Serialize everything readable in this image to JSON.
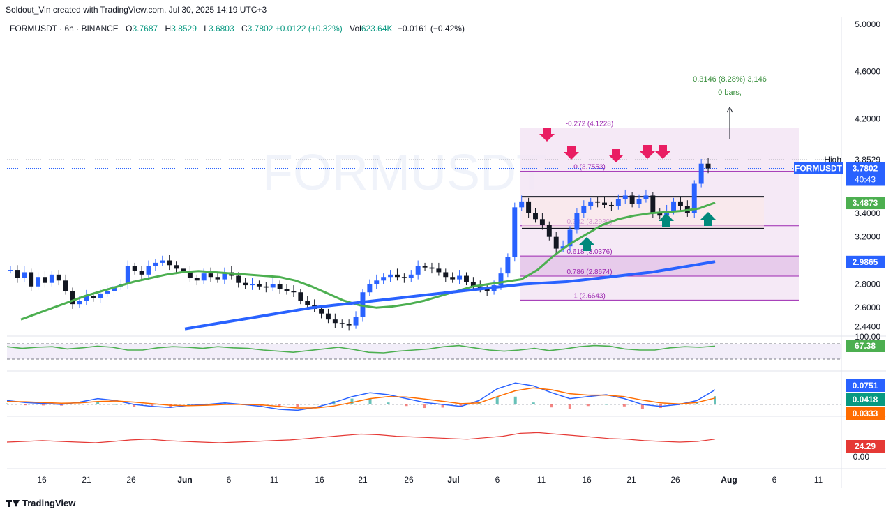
{
  "header": {
    "caption": "Soldout_Vin created with TradingView.com, Jul 30, 2025 14:19 UTC+3"
  },
  "legend": {
    "symbol": "FORMUSDT · 6h · BINANCE",
    "o_label": "O",
    "o": "3.7687",
    "h_label": "H",
    "h": "3.8529",
    "l_label": "L",
    "l": "3.6803",
    "c_label": "C",
    "c": "3.7802",
    "change": "+0.0122 (+0.32%)",
    "vol_label": "Vol",
    "vol": "623.64K",
    "vol_change": "−0.0161 (−0.42%)"
  },
  "footer": {
    "brand": "TradingView"
  },
  "colors": {
    "up": "#089981",
    "down": "#131722",
    "candle_up": "#2962ff",
    "ma_fast": "#4caf50",
    "ma_slow": "#2962ff",
    "fib": "#9c27b0",
    "arrow_down": "#e91e63",
    "arrow_up": "#00897b",
    "rsi": "#4caf50",
    "macd": "#2962ff",
    "signal": "#ff6d00",
    "adx": "#e53935"
  },
  "chart_data": {
    "type": "candlestick",
    "symbol": "FORMUSDT",
    "timeframe": "6h",
    "exchange": "BINANCE",
    "watermark": "FORMUSDT",
    "y_ticks": [
      "5.0000",
      "4.6000",
      "4.2000",
      "3.8529",
      "3.7802",
      "3.4000",
      "3.2000",
      "2.8000",
      "2.6000",
      "2.4400"
    ],
    "y_tick_values": [
      5.0,
      4.6,
      4.2,
      3.4,
      3.2,
      2.8,
      2.6,
      2.44
    ],
    "x_ticks": [
      "16",
      "21",
      "26",
      "Jun",
      "6",
      "11",
      "16",
      "21",
      "26",
      "Jul",
      "6",
      "11",
      "16",
      "21",
      "26",
      "Aug",
      "6",
      "11"
    ],
    "ohlc_last": {
      "open": 3.7687,
      "high": 3.8529,
      "low": 3.6803,
      "close": 3.7802
    },
    "price_labels": {
      "high_label": "High",
      "high_value": "3.8529",
      "symbol_label": "FORMUSDT",
      "last_value": "3.7802",
      "countdown": "40:43",
      "ma_fast_value": "3.4873",
      "ma_slow_value": "2.9865"
    },
    "close_series": [
      2.92,
      2.85,
      2.9,
      2.78,
      2.86,
      2.81,
      2.88,
      2.83,
      2.74,
      2.63,
      2.66,
      2.7,
      2.68,
      2.72,
      2.74,
      2.78,
      2.8,
      2.95,
      2.91,
      2.88,
      2.95,
      2.98,
      3.0,
      2.96,
      2.93,
      2.9,
      2.85,
      2.83,
      2.89,
      2.86,
      2.84,
      2.9,
      2.87,
      2.81,
      2.79,
      2.8,
      2.78,
      2.77,
      2.8,
      2.76,
      2.74,
      2.73,
      2.66,
      2.62,
      2.59,
      2.55,
      2.5,
      2.47,
      2.46,
      2.45,
      2.52,
      2.73,
      2.8,
      2.83,
      2.86,
      2.88,
      2.86,
      2.85,
      2.88,
      2.95,
      2.94,
      2.93,
      2.9,
      2.86,
      2.84,
      2.87,
      2.82,
      2.78,
      2.76,
      2.74,
      2.79,
      2.89,
      3.03,
      3.45,
      3.5,
      3.4,
      3.35,
      3.3,
      3.2,
      3.1,
      3.12,
      3.26,
      3.4,
      3.46,
      3.5,
      3.49,
      3.47,
      3.46,
      3.52,
      3.55,
      3.48,
      3.52,
      3.55,
      3.4,
      3.38,
      3.42,
      3.5,
      3.46,
      3.4,
      3.65,
      3.82,
      3.78
    ],
    "ma_fast_series": [
      2.5,
      2.55,
      2.6,
      2.65,
      2.7,
      2.74,
      2.78,
      2.82,
      2.85,
      2.88,
      2.9,
      2.91,
      2.9,
      2.89,
      2.88,
      2.87,
      2.86,
      2.83,
      2.78,
      2.72,
      2.66,
      2.62,
      2.6,
      2.61,
      2.63,
      2.66,
      2.7,
      2.74,
      2.78,
      2.8,
      2.82,
      2.84,
      2.92,
      3.04,
      3.14,
      3.22,
      3.3,
      3.35,
      3.38,
      3.4,
      3.41,
      3.42,
      3.44,
      3.49
    ],
    "ma_slow_series": [
      2.42,
      2.45,
      2.48,
      2.51,
      2.54,
      2.57,
      2.6,
      2.62,
      2.64,
      2.66,
      2.68,
      2.7,
      2.72,
      2.74,
      2.76,
      2.78,
      2.8,
      2.81,
      2.82,
      2.84,
      2.86,
      2.88,
      2.9,
      2.93,
      2.96,
      2.99
    ],
    "fibonacci": [
      {
        "label": "-0.272 (4.1228)",
        "price": 4.1228
      },
      {
        "label": "0 (3.7553)",
        "price": 3.7553
      },
      {
        "label": "0.382 (3.2939)",
        "price": 3.2939
      },
      {
        "label": "0.618 (3.0376)",
        "price": 3.0376
      },
      {
        "label": "0.786 (2.8674)",
        "price": 2.8674
      },
      {
        "label": "1 (2.6643)",
        "price": 2.6643
      }
    ],
    "range_box": {
      "top": 3.54,
      "bottom": 3.27
    },
    "measure": {
      "line1": "0.3146 (8.28%) 3,146",
      "line2": "0 bars,"
    },
    "rsi": {
      "value": "67.38",
      "top_label": "100.00",
      "series": [
        66,
        63,
        65,
        66,
        62,
        64,
        67,
        65,
        60,
        60,
        64,
        66,
        65,
        63,
        66,
        64,
        63,
        60,
        58,
        56,
        59,
        62,
        65,
        61,
        56,
        55,
        58,
        60,
        62,
        66,
        68,
        64,
        60,
        58,
        60,
        63,
        59,
        62,
        66,
        68,
        67,
        62,
        60,
        60,
        64,
        66,
        65,
        67
      ]
    },
    "macd": {
      "macd_value": "0.0751",
      "hist_value": "0.0418",
      "signal_value": "0.0333",
      "macd_series": [
        0.02,
        0.01,
        0.005,
        0.0,
        0.012,
        0.03,
        0.02,
        0.0,
        -0.01,
        -0.015,
        -0.005,
        0.0,
        0.008,
        0.0,
        -0.01,
        -0.025,
        -0.03,
        -0.015,
        0.01,
        0.04,
        0.06,
        0.05,
        0.03,
        0.01,
        0.0,
        -0.01,
        0.02,
        0.08,
        0.11,
        0.095,
        0.06,
        0.03,
        0.04,
        0.05,
        0.03,
        0.0,
        -0.01,
        0.0,
        0.02,
        0.075
      ],
      "signal_series": [
        0.015,
        0.014,
        0.01,
        0.006,
        0.008,
        0.015,
        0.018,
        0.012,
        0.004,
        -0.004,
        -0.006,
        -0.004,
        0.0,
        0.001,
        -0.002,
        -0.01,
        -0.018,
        -0.018,
        -0.008,
        0.01,
        0.03,
        0.04,
        0.038,
        0.028,
        0.016,
        0.004,
        0.008,
        0.04,
        0.07,
        0.085,
        0.075,
        0.055,
        0.048,
        0.048,
        0.04,
        0.022,
        0.008,
        0.003,
        0.01,
        0.033
      ]
    },
    "adx": {
      "value": "24.29",
      "zero_label": "0.00",
      "series": [
        20,
        21,
        22,
        21,
        20,
        19,
        21,
        23,
        24,
        22,
        21,
        20,
        19,
        20,
        21,
        22,
        23,
        25,
        27,
        29,
        31,
        30,
        28,
        27,
        26,
        25,
        24,
        26,
        28,
        32,
        33,
        31,
        29,
        27,
        25,
        24,
        22,
        21,
        20,
        21,
        24
      ]
    }
  }
}
